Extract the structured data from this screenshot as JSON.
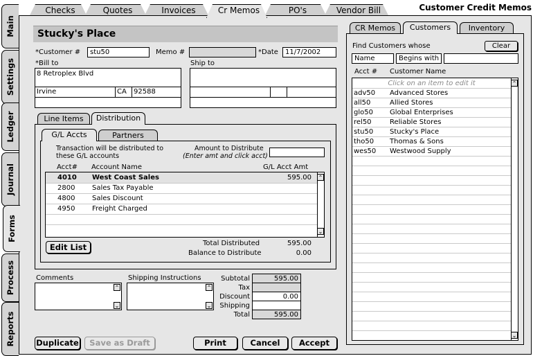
{
  "window_title": "Customer Credit Memos",
  "top_tabs": [
    {
      "label": "Checks"
    },
    {
      "label": "Quotes"
    },
    {
      "label": "Invoices"
    },
    {
      "label": "Cr Memos"
    },
    {
      "label": "PO's"
    },
    {
      "label": "Vendor Bill"
    }
  ],
  "side_tabs": [
    {
      "label": "Main"
    },
    {
      "label": "Settings"
    },
    {
      "label": "Ledger"
    },
    {
      "label": "Journal"
    },
    {
      "label": "Forms"
    },
    {
      "label": "Process"
    },
    {
      "label": "Reports"
    }
  ],
  "header": {
    "customer_name": "Stucky's Place"
  },
  "form": {
    "customer_label": "*Customer #",
    "customer_value": "stu50",
    "memo_label": "Memo #",
    "memo_value": "",
    "date_label": "*Date",
    "date_value": "11/7/2002",
    "bill_to_label": "*Bill to",
    "ship_to_label": "Ship to",
    "bill_address": "8 Retroplex Blvd",
    "bill_city": "Irvine",
    "bill_state": "CA",
    "bill_zip": "92588"
  },
  "section_tabs": [
    {
      "label": "Line Items"
    },
    {
      "label": "Distribution"
    }
  ],
  "sub_tabs": [
    {
      "label": "G/L Accts"
    },
    {
      "label": "Partners"
    }
  ],
  "distribution": {
    "note_line1": "Transaction will be distributed to",
    "note_line2": "these G/L accounts",
    "amount_label": "Amount to Distribute",
    "amount_hint": "(Enter amt and click acct)",
    "amount_value": "",
    "col_acct": "Acct#",
    "col_name": "Account Name",
    "col_amt": "G/L Acct Amt",
    "rows": [
      {
        "acct": "4010",
        "name": "West Coast Sales",
        "amt": "595.00"
      },
      {
        "acct": "2800",
        "name": "Sales Tax Payable",
        "amt": ""
      },
      {
        "acct": "4800",
        "name": "Sales Discount",
        "amt": ""
      },
      {
        "acct": "4950",
        "name": "Freight Charged",
        "amt": ""
      }
    ],
    "edit_list_label": "Edit List",
    "total_distributed_label": "Total Distributed",
    "total_distributed_value": "595.00",
    "balance_label": "Balance to Distribute",
    "balance_value": "0.00"
  },
  "comments_label": "Comments",
  "shipping_instructions_label": "Shipping Instructions",
  "totals": {
    "subtotal_label": "Subtotal",
    "subtotal_value": "595.00",
    "tax_label": "Tax",
    "tax_value": "",
    "discount_label": "Discount",
    "discount_value": "0.00",
    "shipping_label": "Shipping",
    "shipping_value": "",
    "total_label": "Total",
    "total_value": "595.00"
  },
  "buttons": {
    "duplicate": "Duplicate",
    "save_draft": "Save as Draft",
    "print": "Print",
    "cancel": "Cancel",
    "accept": "Accept"
  },
  "right_tabs": [
    {
      "label": "CR Memos"
    },
    {
      "label": "Customers"
    },
    {
      "label": "Inventory"
    }
  ],
  "finder": {
    "find_label": "Find Customers whose",
    "clear_label": "Clear",
    "field_value": "Name",
    "operator_value": "Begins with",
    "search_value": "",
    "col_acct": "Acct #",
    "col_name": "Customer Name",
    "hint": "Click on an item to edit it",
    "customers": [
      {
        "acct": "adv50",
        "name": "Advanced Stores"
      },
      {
        "acct": "all50",
        "name": "Allied Stores"
      },
      {
        "acct": "glo50",
        "name": "Global Enterprises"
      },
      {
        "acct": "rel50",
        "name": "Reliable Stores"
      },
      {
        "acct": "stu50",
        "name": "Stucky's Place"
      },
      {
        "acct": "tho50",
        "name": "Thomas & Sons"
      },
      {
        "acct": "wes50",
        "name": "Westwood Supply"
      }
    ]
  }
}
